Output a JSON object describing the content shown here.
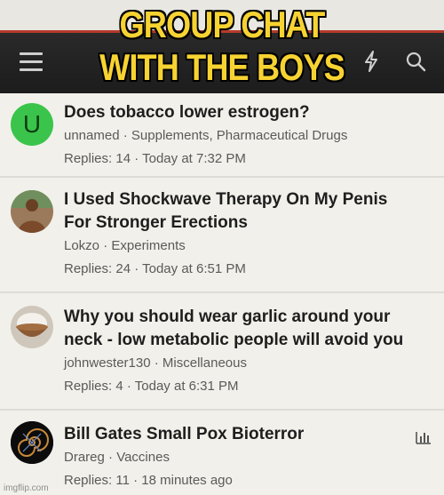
{
  "meme_caption": [
    "GROUP CHAT",
    "WITH THE BOYS"
  ],
  "header": {
    "menu_icon": "hamburger-menu-icon",
    "lightning_icon": "lightning-bolt-icon",
    "search_icon": "search-icon"
  },
  "threads": [
    {
      "avatar_letter": "U",
      "avatar_color": "#3ac44b",
      "title_lines": [
        "Does tobacco lower estrogen?"
      ],
      "author": "unnamed",
      "category": "Supplements, Pharmaceutical Drugs",
      "replies": "Replies: 14",
      "time": "Today at 7:32 PM"
    },
    {
      "avatar_letter": "",
      "title_lines": [
        "I Used Shockwave Therapy On My Penis",
        "For Stronger Erections"
      ],
      "author": "Lokzo",
      "category": "Experiments",
      "replies": "Replies: 24",
      "time": "Today at 6:51 PM"
    },
    {
      "avatar_letter": "",
      "title_lines": [
        "Why you should wear garlic around your",
        "neck - low metabolic people will avoid you"
      ],
      "author": "johnwester130",
      "category": "Miscellaneous",
      "replies": "Replies: 4",
      "time": "Today at 6:31 PM"
    },
    {
      "avatar_letter": "",
      "title_lines": [
        "Bill Gates Small Pox Bioterror"
      ],
      "author": "Drareg",
      "category": "Vaccines",
      "replies": "Replies: 11",
      "time": "18 minutes ago"
    }
  ],
  "watermark": "imgflip.com"
}
